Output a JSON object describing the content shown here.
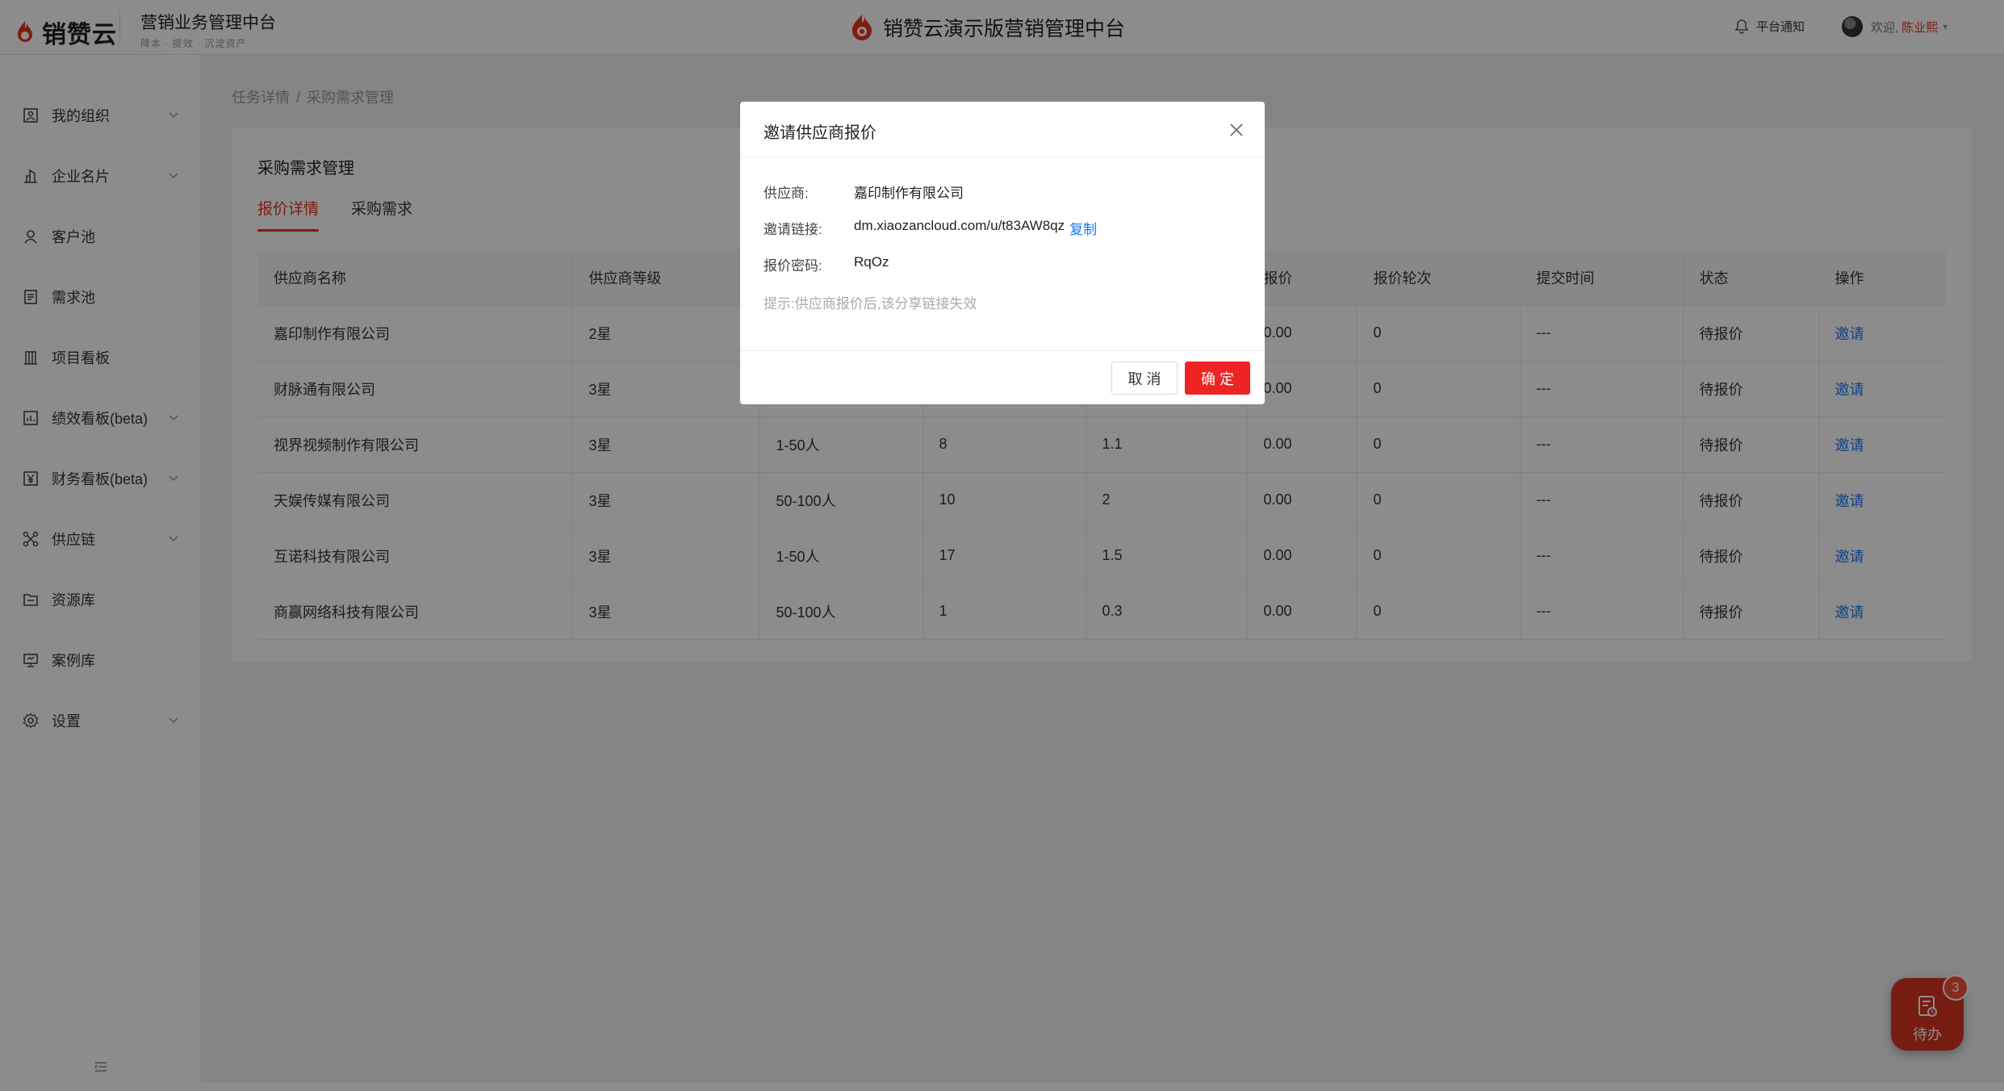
{
  "header": {
    "brand": "销赞云",
    "platform_title": "营销业务管理中台",
    "platform_sub": "降本 · 提效 · 沉淀资产",
    "center_title": "销赞云演示版营销管理中台",
    "notice_label": "平台通知",
    "welcome": "欢迎,",
    "username": "陈业熙"
  },
  "sidebar": {
    "items": [
      {
        "label": "我的组织",
        "icon": "org-icon",
        "has_caret": true
      },
      {
        "label": "企业名片",
        "icon": "building-icon",
        "has_caret": true
      },
      {
        "label": "客户池",
        "icon": "user-icon",
        "has_caret": false
      },
      {
        "label": "需求池",
        "icon": "doc-icon",
        "has_caret": false
      },
      {
        "label": "项目看板",
        "icon": "board-icon",
        "has_caret": false
      },
      {
        "label": "绩效看板(beta)",
        "icon": "chart-icon",
        "has_caret": true
      },
      {
        "label": "财务看板(beta)",
        "icon": "yen-icon",
        "has_caret": true
      },
      {
        "label": "供应链",
        "icon": "network-icon",
        "has_caret": true
      },
      {
        "label": "资源库",
        "icon": "folder-icon",
        "has_caret": false
      },
      {
        "label": "案例库",
        "icon": "presentation-icon",
        "has_caret": false
      },
      {
        "label": "设置",
        "icon": "gear-icon",
        "has_caret": true
      }
    ]
  },
  "breadcrumb": {
    "parent": "任务详情",
    "sep": "/",
    "current": "采购需求管理"
  },
  "card": {
    "title": "采购需求管理",
    "tabs": [
      "报价详情",
      "采购需求"
    ]
  },
  "table": {
    "columns": [
      "供应商名称",
      "供应商等级",
      "",
      "",
      "",
      "报价",
      "报价轮次",
      "提交时间",
      "状态",
      "操作"
    ],
    "rows": [
      [
        "嘉印制作有限公司",
        "2星",
        "",
        "",
        "",
        "0.00",
        "0",
        "---",
        "待报价",
        "邀请"
      ],
      [
        "财脉通有限公司",
        "3星",
        "",
        "",
        "",
        "0.00",
        "0",
        "---",
        "待报价",
        "邀请"
      ],
      [
        "视界视频制作有限公司",
        "3星",
        "1-50人",
        "8",
        "1.1",
        "0.00",
        "0",
        "---",
        "待报价",
        "邀请"
      ],
      [
        "天娱传媒有限公司",
        "3星",
        "50-100人",
        "10",
        "2",
        "0.00",
        "0",
        "---",
        "待报价",
        "邀请"
      ],
      [
        "互诺科技有限公司",
        "3星",
        "1-50人",
        "17",
        "1.5",
        "0.00",
        "0",
        "---",
        "待报价",
        "邀请"
      ],
      [
        "商赢网络科技有限公司",
        "3星",
        "50-100人",
        "1",
        "0.3",
        "0.00",
        "0",
        "---",
        "待报价",
        "邀请"
      ]
    ]
  },
  "modal": {
    "title": "邀请供应商报价",
    "supplier_label": "供应商:",
    "supplier_value": "嘉印制作有限公司",
    "link_label": "邀请链接:",
    "link_value": "dm.xiaozancloud.com/u/t83AW8qz",
    "copy_label": "复制",
    "password_label": "报价密码:",
    "password_value": "RqOz",
    "hint": "提示:供应商报价后,该分享链接失效",
    "cancel_label": "取 消",
    "ok_label": "确 定"
  },
  "todo": {
    "label": "待办",
    "count": "3"
  },
  "colors": {
    "brand": "#e8341c",
    "link": "#1677ff",
    "primary_button": "#ee2424"
  }
}
